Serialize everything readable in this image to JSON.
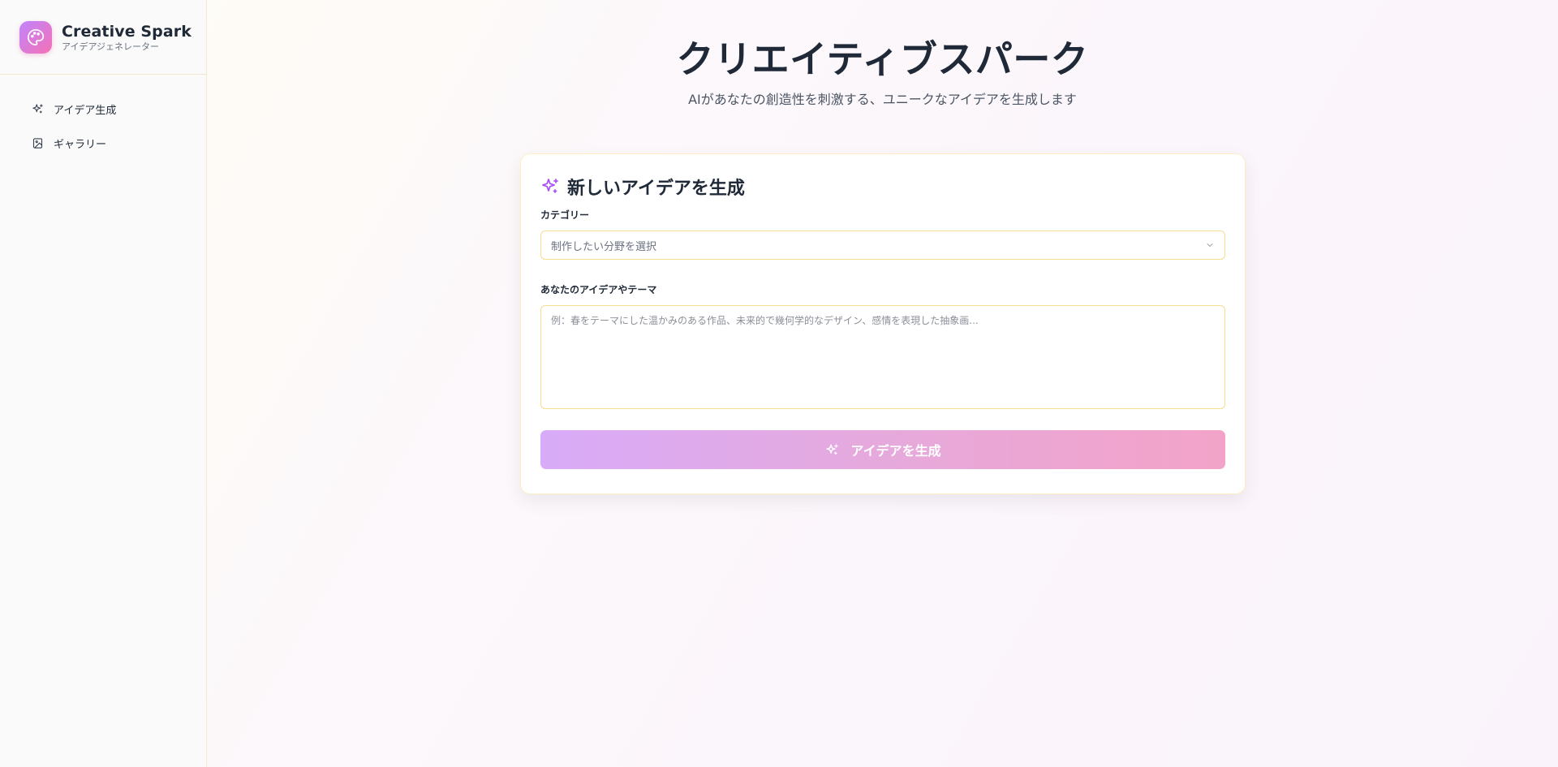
{
  "sidebar": {
    "brand": {
      "title": "Creative Spark",
      "subtitle": "アイデアジェネレーター",
      "icon": "palette-icon"
    },
    "items": [
      {
        "label": "アイデア生成",
        "icon": "sparkles-icon"
      },
      {
        "label": "ギャラリー",
        "icon": "image-icon"
      }
    ]
  },
  "main": {
    "title": "クリエイティブスパーク",
    "subtitle": "AIがあなたの創造性を刺激する、ユニークなアイデアを生成します",
    "card": {
      "title": "新しいアイデアを生成",
      "category_label": "カテゴリー",
      "category_placeholder": "制作したい分野を選択",
      "idea_label": "あなたのアイデアやテーマ",
      "idea_placeholder": "例：春をテーマにした温かみのある作品、未来的で幾何学的なデザイン、感情を表現した抽象画...",
      "generate_label": "アイデアを生成"
    }
  },
  "colors": {
    "accent_purple": "#a855f7",
    "accent_pink": "#f472b6",
    "input_border": "#f6dc8f"
  }
}
